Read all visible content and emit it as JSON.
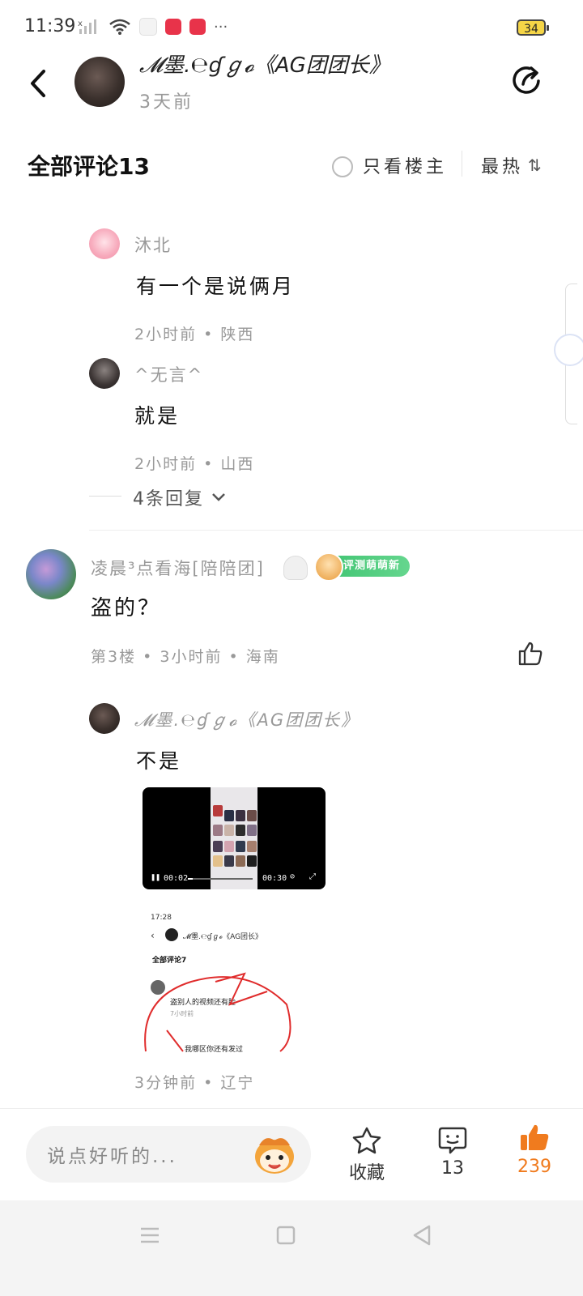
{
  "status_bar": {
    "time": "11:39",
    "battery": "34",
    "more": "···"
  },
  "header": {
    "author": "𝓜墨.℮ɠℊ𝓸《AG团团长》",
    "time": "3天前"
  },
  "comments_header": {
    "title": "全部评论13",
    "only_op": "只看楼主",
    "sort": "最热"
  },
  "replies_top": [
    {
      "nick": "沐北",
      "text": "有一个是说俩月",
      "meta": "2小时前 • 陕西"
    },
    {
      "nick": "^无言^",
      "text": "就是",
      "meta": "2小时前 • 山西"
    }
  ],
  "more_replies": "4条回复",
  "floor3": {
    "nick": "凌晨³点看海[陪陪团]",
    "badge": "评测萌萌新",
    "text": "盗的？",
    "meta": "第3楼 • 3小时前 • 海南",
    "reply": {
      "nick": "𝓜墨.℮ɠℊ𝓸《AG团团长》",
      "text": "不是",
      "meta": "3分钟前 • 辽宁",
      "video": {
        "time_current": "00:02",
        "time_total": "00:30",
        "progress": 0.07
      },
      "screenshot": {
        "time": "17:28",
        "header": "𝓜墨.℮ɠℊ𝓸《AG团长》",
        "title": "全部评论7",
        "line1": "盗别人的视频还有脸",
        "line2": "我哪区你还有发过",
        "meta": "7小时前"
      }
    }
  },
  "bottom_bar": {
    "placeholder": "说点好听的...",
    "favorite_label": "收藏",
    "comment_count": "13",
    "like_count": "239"
  },
  "colors": {
    "accent_orange": "#f07b1e",
    "badge_green": "#3cc26f",
    "muted": "#999999"
  },
  "icons": [
    "back-icon",
    "share-icon",
    "radio-icon",
    "sort-icon",
    "chevron-down-icon",
    "like-icon",
    "star-icon",
    "comment-icon",
    "thumb-up-icon",
    "menu-icon",
    "home-icon",
    "back-triangle-icon"
  ]
}
